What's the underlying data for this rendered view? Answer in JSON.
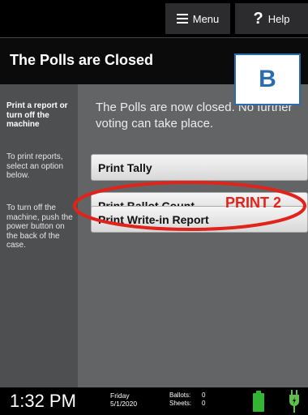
{
  "topbar": {
    "menu_label": "Menu",
    "help_label": "Help"
  },
  "title": "The Polls are Closed",
  "sidebar": {
    "heading": "Print a report or turn off the machine",
    "text1": "To print reports, select an option below.",
    "text2": "To turn off the machine, push the power button on the back of the case."
  },
  "message": "The Polls are now closed. No further voting can take place.",
  "buttons": {
    "print_tally": "Print Tally",
    "print_ballot_count": "Print Ballot Count",
    "print_writein": "Print Write-in Report"
  },
  "annotations": {
    "box_letter": "B",
    "print_label": "PRINT 2",
    "highlight_color": "#e0231b",
    "box_color": "#2b6cb0"
  },
  "status": {
    "time": "1:32 PM",
    "day": "Friday",
    "date": "5/1/2020",
    "ballots_label": "Ballots:",
    "ballots_value": "0",
    "sheets_label": "Sheets:",
    "sheets_value": "0",
    "battery_color": "#33b533",
    "power_color": "#5cc04a"
  }
}
